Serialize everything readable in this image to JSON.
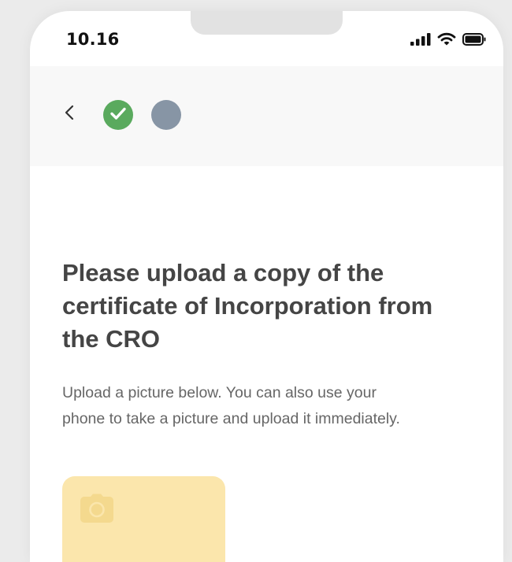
{
  "status_bar": {
    "time": "10.16",
    "icons": [
      "cellular-signal-icon",
      "wifi-icon",
      "battery-icon"
    ]
  },
  "header": {
    "back_icon": "chevron-left-icon",
    "steps": [
      {
        "state": "completed",
        "icon": "checkmark-icon",
        "color": "#5aaa5e"
      },
      {
        "state": "current",
        "color": "#8795a5"
      }
    ]
  },
  "content": {
    "title": "Please upload a copy of the certificate of Incorporation from the CRO",
    "description": "Upload a picture below. You can also use your phone to take a picture and upload it immediately."
  },
  "upload": {
    "icon": "camera-icon",
    "background": "#fbe6ac"
  }
}
